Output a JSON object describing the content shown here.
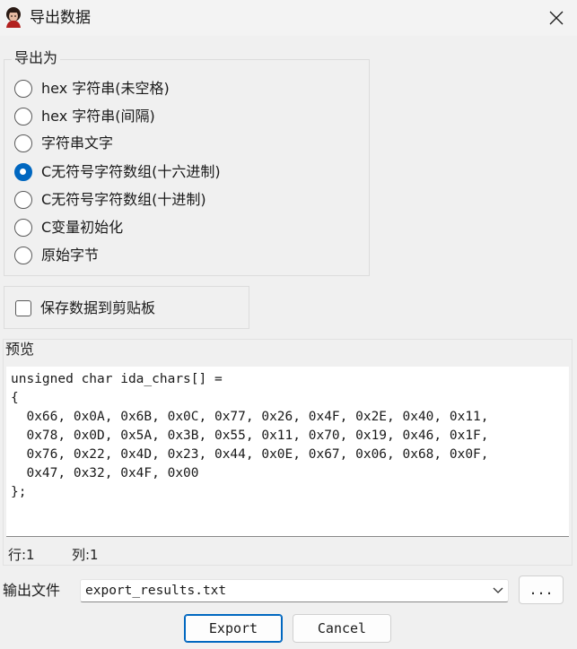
{
  "window": {
    "title": "导出数据",
    "icon": "ida-app-icon",
    "close_icon": "close-icon"
  },
  "export_as": {
    "label": "导出为",
    "options": [
      {
        "label": "hex 字符串(未空格)",
        "checked": false
      },
      {
        "label": "hex 字符串(间隔)",
        "checked": false
      },
      {
        "label": "字符串文字",
        "checked": false
      },
      {
        "label": "C无符号字符数组(十六进制)",
        "checked": true
      },
      {
        "label": "C无符号字符数组(十进制)",
        "checked": false
      },
      {
        "label": "C变量初始化",
        "checked": false
      },
      {
        "label": "原始字节",
        "checked": false
      }
    ]
  },
  "clipboard": {
    "label": "保存数据到剪贴板",
    "checked": false
  },
  "preview": {
    "label": "预览",
    "lines": [
      "unsigned char ida_chars[] =",
      "{",
      "  0x66, 0x0A, 0x6B, 0x0C, 0x77, 0x26, 0x4F, 0x2E, 0x40, 0x11,",
      "  0x78, 0x0D, 0x5A, 0x3B, 0x55, 0x11, 0x70, 0x19, 0x46, 0x1F,",
      "  0x76, 0x22, 0x4D, 0x23, 0x44, 0x0E, 0x67, 0x06, 0x68, 0x0F,",
      "  0x47, 0x32, 0x4F, 0x00",
      "};"
    ]
  },
  "status": {
    "row": "行:1",
    "col": "列:1"
  },
  "output": {
    "label": "输出文件",
    "value": "export_results.txt",
    "browse_label": "..."
  },
  "buttons": {
    "export": "Export",
    "cancel": "Cancel"
  },
  "colors": {
    "accent": "#0067c0",
    "background": "#f0f0f0"
  }
}
